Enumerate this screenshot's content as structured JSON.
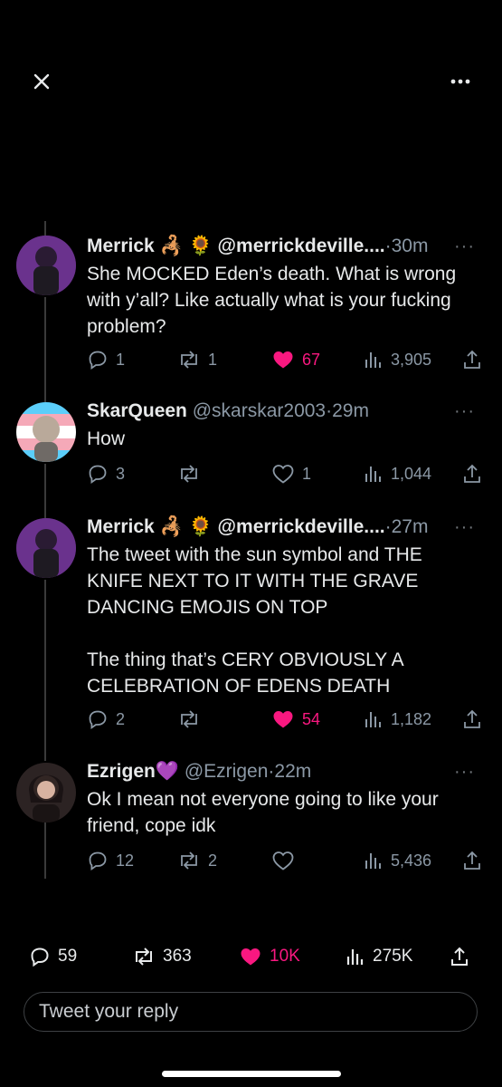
{
  "top": {
    "close_icon": "close-icon",
    "more_icon": "more-horizontal-icon"
  },
  "tweets": [
    {
      "name": "Merrick",
      "emoji": "🦂 🌻",
      "handle": "@merrickdeville....",
      "time": "·30m",
      "text": "She MOCKED Eden’s death. What is wrong with y’all? Like actually what is your fucking problem?",
      "replies": "1",
      "retweets": "1",
      "likes": "67",
      "views": "3,905",
      "liked": true,
      "avatar_color": "#5b2b7a"
    },
    {
      "name": "SkarQueen",
      "handle": "@skarskar2003",
      "time": "·29m",
      "text": "How",
      "replies": "3",
      "retweets": "",
      "likes": "1",
      "views": "1,044",
      "liked": false,
      "avatar_color": "#8fb6d8"
    },
    {
      "name": "Merrick",
      "emoji": "🦂 🌻",
      "handle": "@merrickdeville....",
      "time": "·27m",
      "text": "The tweet with the sun symbol and THE KNIFE NEXT TO IT WITH THE GRAVE DANCING EMOJIS ON TOP\n\nThe thing that’s CERY OBVIOUSLY A CELEBRATION OF EDENS DEATH",
      "replies": "2",
      "retweets": "",
      "likes": "54",
      "views": "1,182",
      "liked": true,
      "avatar_color": "#5b2b7a"
    },
    {
      "name": "Ezrigen",
      "emoji": "💜",
      "handle": "@Ezrigen",
      "time": "·22m",
      "text": "Ok I mean not everyone going to like your friend, cope idk",
      "replies": "12",
      "retweets": "2",
      "likes": "",
      "views": "5,436",
      "liked": false,
      "avatar_color": "#3a2a2a"
    }
  ],
  "bottom": {
    "replies": "59",
    "retweets": "363",
    "likes": "10K",
    "views": "275K"
  },
  "reply": {
    "placeholder": "Tweet your reply"
  },
  "colors": {
    "like": "#f91880",
    "muted": "#8b98a5",
    "background": "#000000"
  }
}
